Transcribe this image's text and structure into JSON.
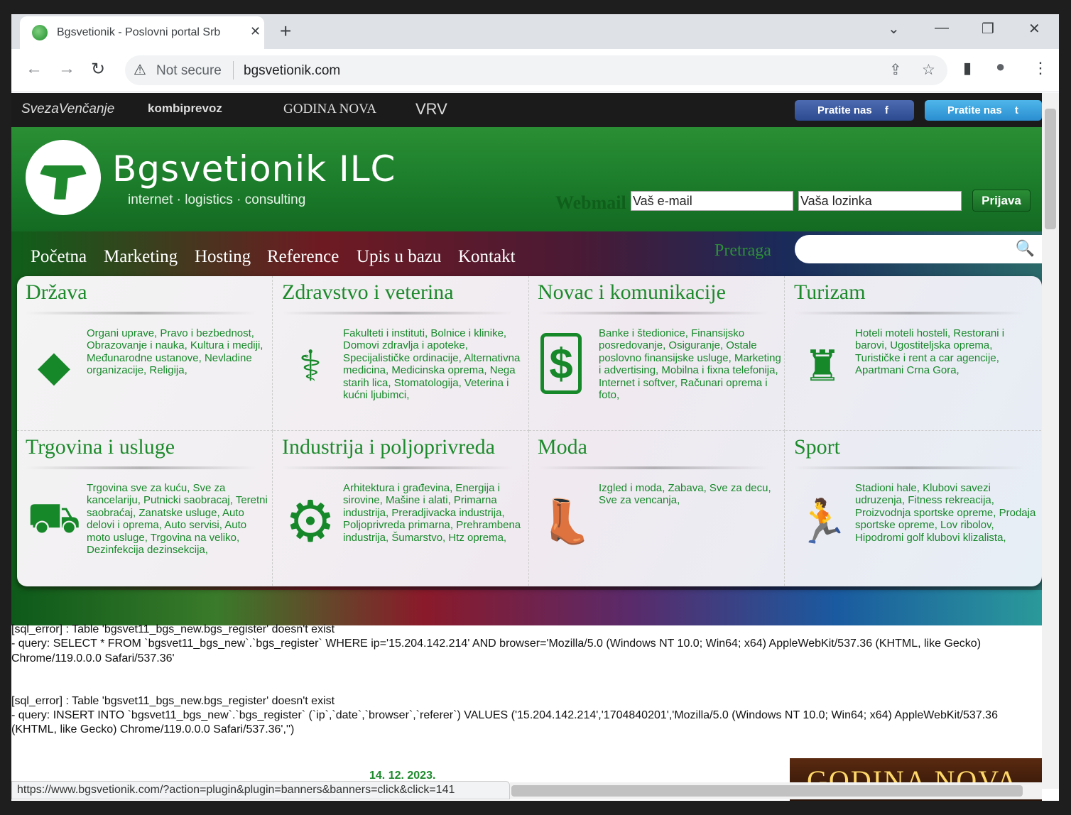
{
  "tab": {
    "title": "Bgsvetionik - Poslovni portal Srb",
    "close": "✕",
    "new_tab": "+"
  },
  "window_controls": {
    "tab_list": "⌄",
    "minimize": "—",
    "restore": "❐",
    "close": "✕"
  },
  "toolbar": {
    "back": "←",
    "forward": "→",
    "reload": "↻",
    "warn": "⚠",
    "not_secure": "Not secure",
    "url": "bgsvetionik.com",
    "share": "⇪",
    "star": "☆",
    "sidepanel": "▮",
    "profile": "●",
    "menu": "⋮"
  },
  "topbar": {
    "logos": [
      "SvezaVenčanje",
      "kombiprevoz",
      "GODINA NOVA",
      "VRV"
    ],
    "facebook": "Pratite nas",
    "twitter": "Pratite nas"
  },
  "header": {
    "brand": "Bgsvetionik ILC",
    "tagline": "internet · logistics · consulting",
    "webmail": "Webmail",
    "email_value": "Vaš e-mail",
    "password_value": "Vaša lozinka",
    "login": "Prijava"
  },
  "menu": [
    "Početna",
    "Marketing",
    "Hosting",
    "Reference",
    "Upis u bazu",
    "Kontakt"
  ],
  "search": {
    "label": "Pretraga",
    "icon": "🔍"
  },
  "categories": [
    {
      "title": "Država",
      "icon": "map-icon",
      "glyph": "◆",
      "links": "Organi uprave, Pravo i bezbednost, Obrazovanje i nauka, Kultura i mediji, Međunarodne ustanove, Nevladine organizacije, Religija,"
    },
    {
      "title": "Zdravstvo i veterina",
      "icon": "caduceus-icon",
      "glyph": "⚕",
      "links": "Fakulteti i instituti, Bolnice i klinike, Domovi zdravlja i apoteke, Specijalističke ordinacije, Alternativna medicina, Medicinska oprema, Nega starih lica, Stomatologija, Veterina i kućni ljubimci,"
    },
    {
      "title": "Novac i komunikacije",
      "icon": "phone-dollar-icon",
      "glyph": "$",
      "links": "Banke i štedionice, Finansijsko posredovanje, Osiguranje, Ostale poslovno finansijske usluge, Marketing i advertising, Mobilna i fixna telefonija, Internet i softver, Računari oprema i foto,"
    },
    {
      "title": "Turizam",
      "icon": "traveler-icon",
      "glyph": "♜",
      "links": "Hoteli moteli hosteli, Restorani i barovi, Ugostiteljska oprema, Turističke i rent a car agencije, Apartmani Crna Gora,"
    },
    {
      "title": "Trgovina i usluge",
      "icon": "cart-icon",
      "glyph": "⛟",
      "links": "Trgovina sve za kuću, Sve za kancelariju, Putnicki saobracaj, Teretni saobraćaj, Zanatske usluge, Auto delovi i oprema, Auto servisi, Auto moto usluge, Trgovina na veliko, Dezinfekcija dezinsekcija,"
    },
    {
      "title": "Industrija i poljoprivreda",
      "icon": "gears-icon",
      "glyph": "⚙",
      "links": "Arhitektura i građevina, Energija i sirovine, Mašine i alati, Primarna industrija, Preradjivacka industrija, Poljoprivreda primarna, Prehrambena industrija, Šumarstvo, Htz oprema,"
    },
    {
      "title": "Moda",
      "icon": "boot-icon",
      "glyph": "👢",
      "links": "Izgled i moda, Zabava, Sve za decu, Sve za vencanja,"
    },
    {
      "title": "Sport",
      "icon": "runner-icon",
      "glyph": "🏃",
      "links": "Stadioni hale, Klubovi savezi udruzenja, Fitness rekreacija, Proizvodnja sportske opreme, Prodaja sportske opreme, Lov ribolov, Hipodromi golf klubovi klizalista,"
    }
  ],
  "errors": [
    {
      "line1": "[sql_error] : Table 'bgsvet11_bgs_new.bgs_register' doesn't exist",
      "line2": "- query: SELECT * FROM `bgsvet11_bgs_new`.`bgs_register` WHERE ip='15.204.142.214' AND browser='Mozilla/5.0 (Windows NT 10.0; Win64; x64) AppleWebKit/537.36 (KHTML, like Gecko) Chrome/119.0.0.0 Safari/537.36'"
    },
    {
      "line1": "[sql_error] : Table 'bgsvet11_bgs_new.bgs_register' doesn't exist",
      "line2": "- query: INSERT INTO `bgsvet11_bgs_new`.`bgs_register` (`ip`,`date`,`browser`,`referer`) VALUES ('15.204.142.214','1704840201','Mozilla/5.0 (Windows NT 10.0; Win64; x64) AppleWebKit/537.36 (KHTML, like Gecko) Chrome/119.0.0.0 Safari/537.36','')"
    }
  ],
  "date": "14. 12. 2023.",
  "banner": "GODINA NOVA",
  "status_url": "https://www.bgsvetionik.com/?action=plugin&plugin=banners&banners=click&click=141"
}
